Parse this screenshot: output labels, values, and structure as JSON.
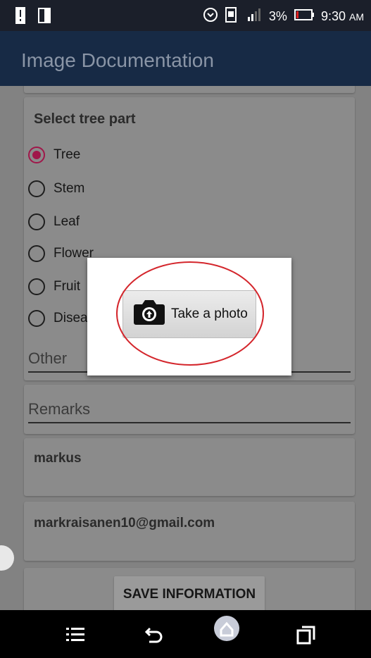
{
  "status_bar": {
    "battery_percent": "3%",
    "time": "9:30",
    "am_pm": "AM"
  },
  "app_bar": {
    "title": "Image Documentation"
  },
  "form": {
    "section_title": "Select tree part",
    "options": [
      {
        "label": "Tree",
        "checked": true
      },
      {
        "label": "Stem",
        "checked": false
      },
      {
        "label": "Leaf",
        "checked": false
      },
      {
        "label": "Flower",
        "checked": false
      },
      {
        "label": "Fruit",
        "checked": false
      },
      {
        "label": "Disea",
        "checked": false
      }
    ],
    "other_placeholder": "Other",
    "remarks_placeholder": "Remarks",
    "name_value": "markus",
    "email_value": "markraisanen10@gmail.com",
    "save_label": "SAVE INFORMATION"
  },
  "dialog": {
    "take_photo_label": "Take a photo"
  },
  "colors": {
    "accent": "#a0174a",
    "app_bar": "#172a45",
    "annotation_circle": "#d4262c"
  },
  "nav_icons": [
    "menu-icon",
    "back-icon",
    "home-icon",
    "recents-icon"
  ]
}
